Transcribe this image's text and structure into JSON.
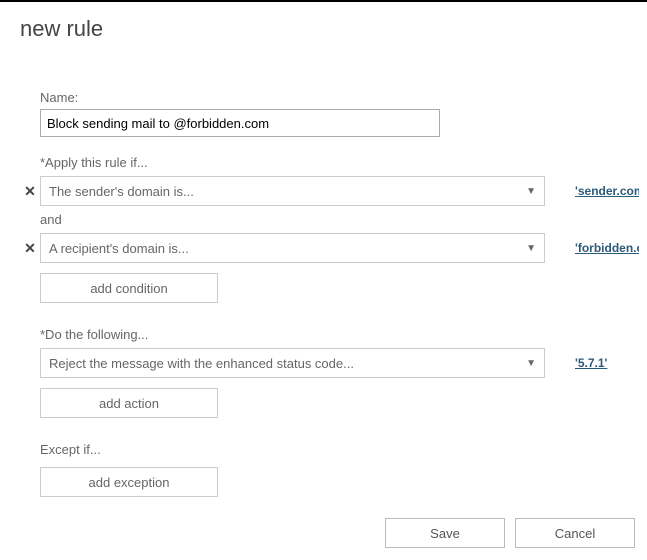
{
  "title": "new rule",
  "name": {
    "label": "Name:",
    "value": "Block sending mail to @forbidden.com"
  },
  "apply_if": {
    "label": "*Apply this rule if...",
    "conditions": [
      {
        "text": "The sender's domain is...",
        "value": "'sender.com'"
      },
      {
        "text": "A recipient's domain is...",
        "value": "'forbidden.com'"
      }
    ],
    "and_label": "and",
    "add_label": "add condition"
  },
  "do_following": {
    "label": "*Do the following...",
    "actions": [
      {
        "text": "Reject the message with the enhanced status code...",
        "value": "'5.7.1'"
      }
    ],
    "add_label": "add action"
  },
  "except_if": {
    "label": "Except if...",
    "add_label": "add exception"
  },
  "footer": {
    "save": "Save",
    "cancel": "Cancel"
  }
}
